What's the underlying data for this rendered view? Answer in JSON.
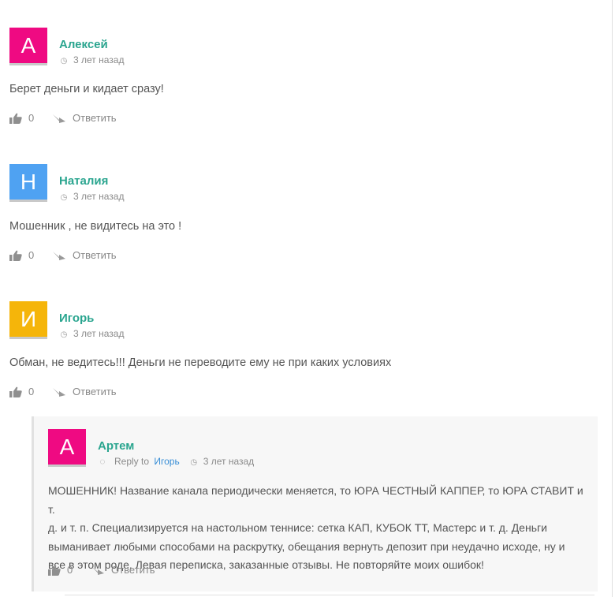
{
  "comments": [
    {
      "avatar_letter": "А",
      "avatar_color": "#ef0a82",
      "author": "Алексей",
      "time": "3 лет назад",
      "text": "Берет деньги и кидает сразу!",
      "likes": "0",
      "reply_label": "Ответить"
    },
    {
      "avatar_letter": "Н",
      "avatar_color": "#4fa2f2",
      "author": "Наталия",
      "time": "3 лет назад",
      "text": "Мошенник , не видитесь на это !",
      "likes": "0",
      "reply_label": "Ответить"
    },
    {
      "avatar_letter": "И",
      "avatar_color": "#f5b50a",
      "author": "Игорь",
      "time": "3 лет назад",
      "text": "Обман, не ведитесь!!! Деньги не переводите ему не при каких условиях",
      "likes": "0",
      "reply_label": "Ответить"
    }
  ],
  "reply": {
    "avatar_letter": "А",
    "avatar_color": "#ef0a82",
    "author": "Артем",
    "reply_to_label": "Reply to",
    "reply_to_name": "Игорь",
    "time": "3 лет назад",
    "text_lines": [
      "МОШЕННИК! Название канала периодически меняется, то ЮРА ЧЕСТНЫЙ КАППЕР, то ЮРА СТАВИТ и т.",
      "д. и т. п. Специализируется на настольном теннисе: сетка КАП, КУБОК ТТ, Мастерс и т. д. Деньги",
      "выманивает любыми способами на раскрутку, обещания вернуть депозит при неудачно исходе, ну и",
      "все в этом роде. Левая переписка, заказанные отзывы. Не повторяйте моих ошибок!"
    ],
    "likes": "0",
    "reply_label": "Ответить"
  },
  "icons": {
    "clock": "clock-icon",
    "like": "thumbs-up-icon",
    "reply": "reply-arrow-icon",
    "reply_to": "speech-bubble-icon"
  }
}
